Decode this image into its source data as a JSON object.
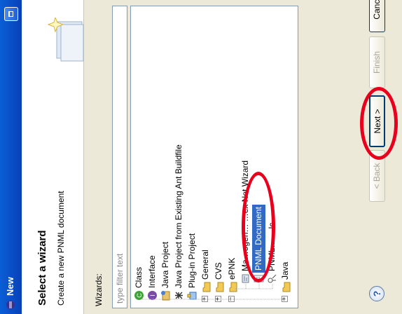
{
  "window": {
    "title": "New"
  },
  "header": {
    "title": "Select a wizard",
    "description": "Create a new PNML document"
  },
  "wizards_label": "Wizards:",
  "filter": {
    "placeholder": "type filter text"
  },
  "tree": [
    {
      "label": "Class",
      "icon": "class-icon"
    },
    {
      "label": "Interface",
      "icon": "interface-icon"
    },
    {
      "label": "Java Project",
      "icon": "java-project-icon"
    },
    {
      "label": "Java Project from Existing Ant Buildfile",
      "icon": "ant-project-icon"
    },
    {
      "label": "Plug-in Project",
      "icon": "plugin-project-icon"
    },
    {
      "label": "General",
      "icon": "folder-icon"
    },
    {
      "label": "CVS",
      "icon": "folder-icon"
    },
    {
      "label": "ePNK",
      "icon": "folder-icon"
    },
    {
      "label": "Ma…ogen…    …ex Net Wizard",
      "icon": "wizard-icon"
    },
    {
      "label": "PNML Document",
      "icon": "pnml-document-icon",
      "selected": true
    },
    {
      "label": "PNML…   …lc…",
      "icon": "wizard-icon"
    },
    {
      "label": "Java",
      "icon": "folder-icon"
    }
  ],
  "buttons": {
    "back": "< Back",
    "next": "Next >",
    "finish": "Finish",
    "cancel": "Cancel",
    "help": "?"
  },
  "colors": {
    "selection": "#316ac5",
    "annotation": "#e8001c",
    "titlebar": "#0a5fd6"
  }
}
